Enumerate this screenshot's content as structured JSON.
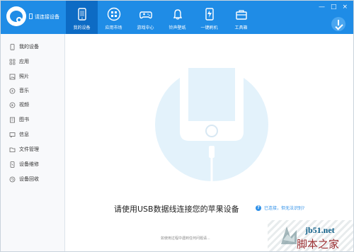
{
  "app": {
    "device_status": "请连接设备"
  },
  "nav": [
    {
      "label": "我的设备",
      "icon": "phone-icon",
      "active": true
    },
    {
      "label": "应用市场",
      "icon": "apps-market-icon",
      "active": false
    },
    {
      "label": "游戏中心",
      "icon": "gamepad-icon",
      "active": false
    },
    {
      "label": "铃声壁纸",
      "icon": "bell-icon",
      "active": false
    },
    {
      "label": "一键刷机",
      "icon": "flash-icon",
      "active": false
    },
    {
      "label": "工具箱",
      "icon": "toolbox-icon",
      "active": false
    }
  ],
  "window_controls": {
    "minimize": "—",
    "maximize": "□",
    "close": "×"
  },
  "sidebar": [
    {
      "label": "我的设备",
      "icon": "device-icon"
    },
    {
      "label": "应用",
      "icon": "grid-icon"
    },
    {
      "label": "照片",
      "icon": "image-icon"
    },
    {
      "label": "音乐",
      "icon": "music-icon"
    },
    {
      "label": "视频",
      "icon": "video-icon"
    },
    {
      "label": "图书",
      "icon": "book-icon"
    },
    {
      "label": "信息",
      "icon": "message-icon"
    },
    {
      "label": "文件管理",
      "icon": "folder-icon"
    },
    {
      "label": "设备维修",
      "icon": "repair-icon"
    },
    {
      "label": "设备回收",
      "icon": "recycle-icon"
    }
  ],
  "main": {
    "prompt": "请使用USB数据线连接您的苹果设备",
    "help_link": "已连接，但无法识别?",
    "bottom_note": "如使用过程中遇到任何问题请..."
  },
  "watermark": {
    "url": "jb51.net",
    "brand": "脚本之家"
  },
  "colors": {
    "topbar": "#1f8ce6",
    "active_nav": "#0d6bc4",
    "illustration": "#e3f2fb",
    "link": "#2f90e8"
  }
}
